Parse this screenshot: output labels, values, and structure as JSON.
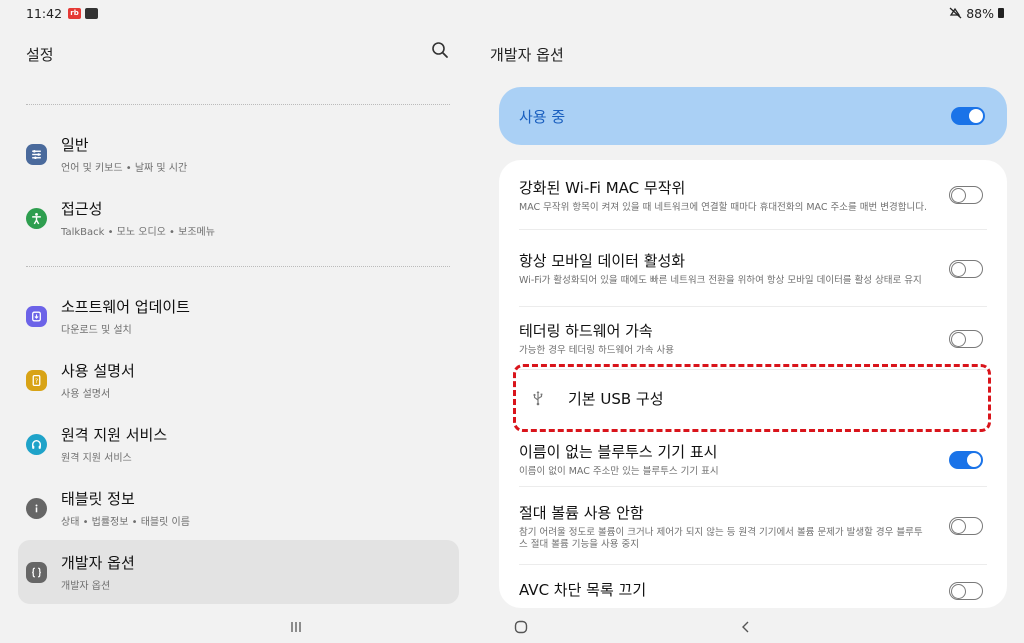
{
  "status_bar": {
    "time": "11:42",
    "battery": "88%"
  },
  "left_panel": {
    "title": "설정",
    "items": [
      {
        "title": "일반",
        "subtitle": "언어 및 키보드 • 날짜 및 시간",
        "icon": "sliders-icon",
        "color": "#4a6a9c"
      },
      {
        "title": "접근성",
        "subtitle": "TalkBack • 모노 오디오 • 보조메뉴",
        "icon": "accessibility-icon",
        "color": "#2e9e4f"
      },
      {
        "title": "소프트웨어 업데이트",
        "subtitle": "다운로드 및 설치",
        "icon": "update-icon",
        "color": "#6c63e8"
      },
      {
        "title": "사용 설명서",
        "subtitle": "사용 설명서",
        "icon": "manual-icon",
        "color": "#d8a316"
      },
      {
        "title": "원격 지원 서비스",
        "subtitle": "원격 지원 서비스",
        "icon": "headset-icon",
        "color": "#1fa3c9"
      },
      {
        "title": "태블릿 정보",
        "subtitle": "상태 • 법률정보 • 태블릿 이름",
        "icon": "info-icon",
        "color": "#666666"
      },
      {
        "title": "개발자 옵션",
        "subtitle": "개발자 옵션",
        "icon": "braces-icon",
        "color": "#666666"
      }
    ]
  },
  "right_panel": {
    "title": "개발자 옵션",
    "master": {
      "label": "사용 중",
      "on": true
    },
    "rows": [
      {
        "title": "강화된 Wi-Fi MAC 무작위",
        "subtitle": "MAC 무작위 항목이 켜져 있을 때 네트워크에 연결할 때마다 휴대전화의 MAC 주소를 매번 변경합니다.",
        "on": false
      },
      {
        "title": "항상 모바일 데이터 활성화",
        "subtitle": "Wi-Fi가 활성화되어 있을 때에도 빠른 네트워크 전환을 위하여 항상 모바일 데이터를 활성 상태로 유지",
        "on": false
      },
      {
        "title": "테더링 하드웨어 가속",
        "subtitle": "가능한 경우 테더링 하드웨어 가속 사용",
        "on": false
      },
      {
        "title": "이름이 없는 블루투스 기기 표시",
        "subtitle": "이름이 없이 MAC 주소만 있는 블루투스 기기 표시",
        "on": true
      },
      {
        "title": "절대 볼륨 사용 안함",
        "subtitle": "참기 어려울 정도로 볼륨이 크거나 제어가 되지 않는 등 원격 기기에서 볼륨 문제가 발생할 경우 블루투스 절대 볼륨 기능을 사용 중지",
        "on": false
      },
      {
        "title": "AVC 차단 목록 끄기",
        "subtitle": "",
        "on": false
      }
    ],
    "usb_config": {
      "label": "기본 USB 구성",
      "icon": "usb-icon"
    }
  },
  "navbar": {
    "recents": "recents-icon",
    "home": "home-icon",
    "back": "back-icon"
  },
  "colors": {
    "accent": "#1a73e8",
    "highlight": "#d9141b",
    "master_bg": "#aad0f5"
  }
}
